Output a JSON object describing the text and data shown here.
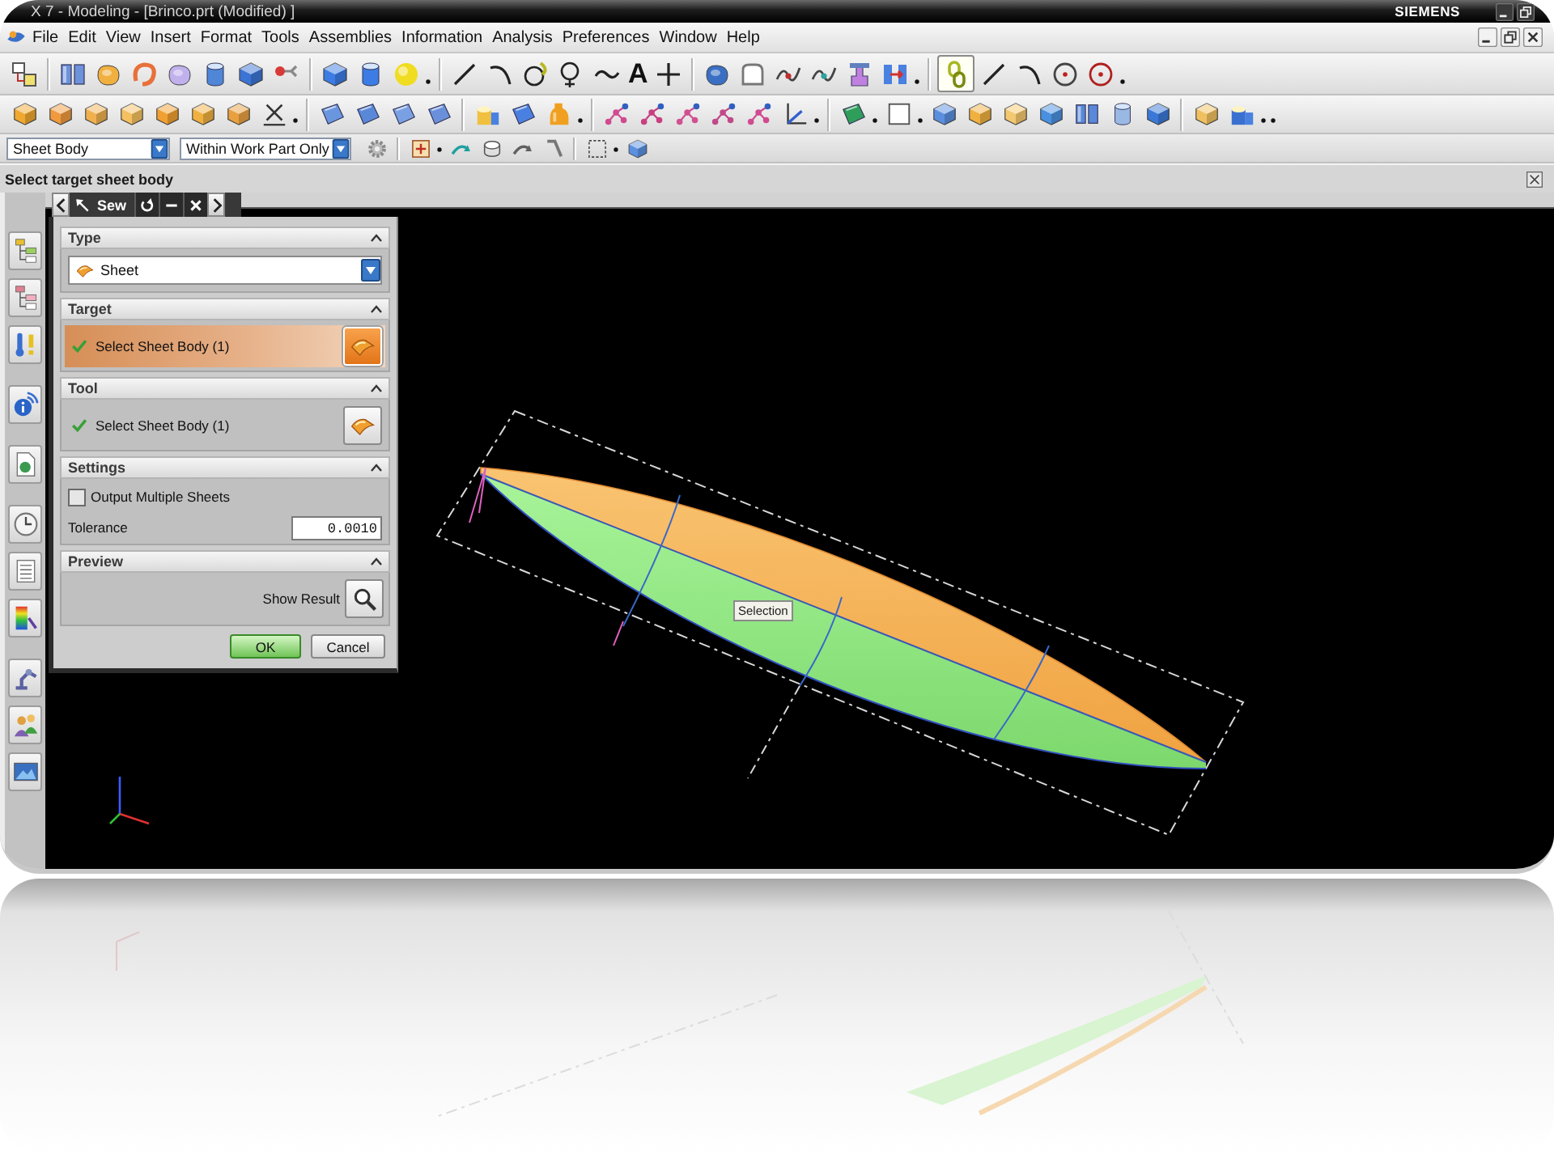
{
  "title_bar": {
    "title": "X 7 - Modeling - [Brinco.prt (Modified) ]",
    "brand": "SIEMENS"
  },
  "menu_bar": {
    "items": [
      "File",
      "Edit",
      "View",
      "Insert",
      "Format",
      "Tools",
      "Assemblies",
      "Information",
      "Analysis",
      "Preferences",
      "Window",
      "Help"
    ]
  },
  "toolbar": {
    "text_tool": "A",
    "link_toggle": {
      "on": true
    }
  },
  "selection_bar": {
    "type_filter": "Sheet Body",
    "scope_filter": "Within Work Part Only"
  },
  "cue_line": "Select target sheet body",
  "dialog": {
    "title": "Sew",
    "groups": [
      {
        "kind": "type",
        "title": "Type",
        "expanded": true,
        "value": "Sheet"
      },
      {
        "kind": "selection",
        "title": "Target",
        "expanded": true,
        "label": "Select Sheet Body (1)",
        "done": true,
        "selected": true
      },
      {
        "kind": "selection",
        "title": "Tool",
        "expanded": true,
        "label": "Select Sheet Body (1)",
        "done": true,
        "selected": false
      },
      {
        "kind": "settings",
        "title": "Settings",
        "expanded": true,
        "checkbox": {
          "label": "Output Multiple Sheets",
          "checked": false
        },
        "field": {
          "label": "Tolerance",
          "value": "0.0010"
        }
      },
      {
        "kind": "preview",
        "title": "Preview",
        "expanded": true,
        "button_label": "Show Result"
      }
    ],
    "ok": "OK",
    "cancel": "Cancel"
  },
  "viewport": {
    "tooltip": "Selection"
  }
}
